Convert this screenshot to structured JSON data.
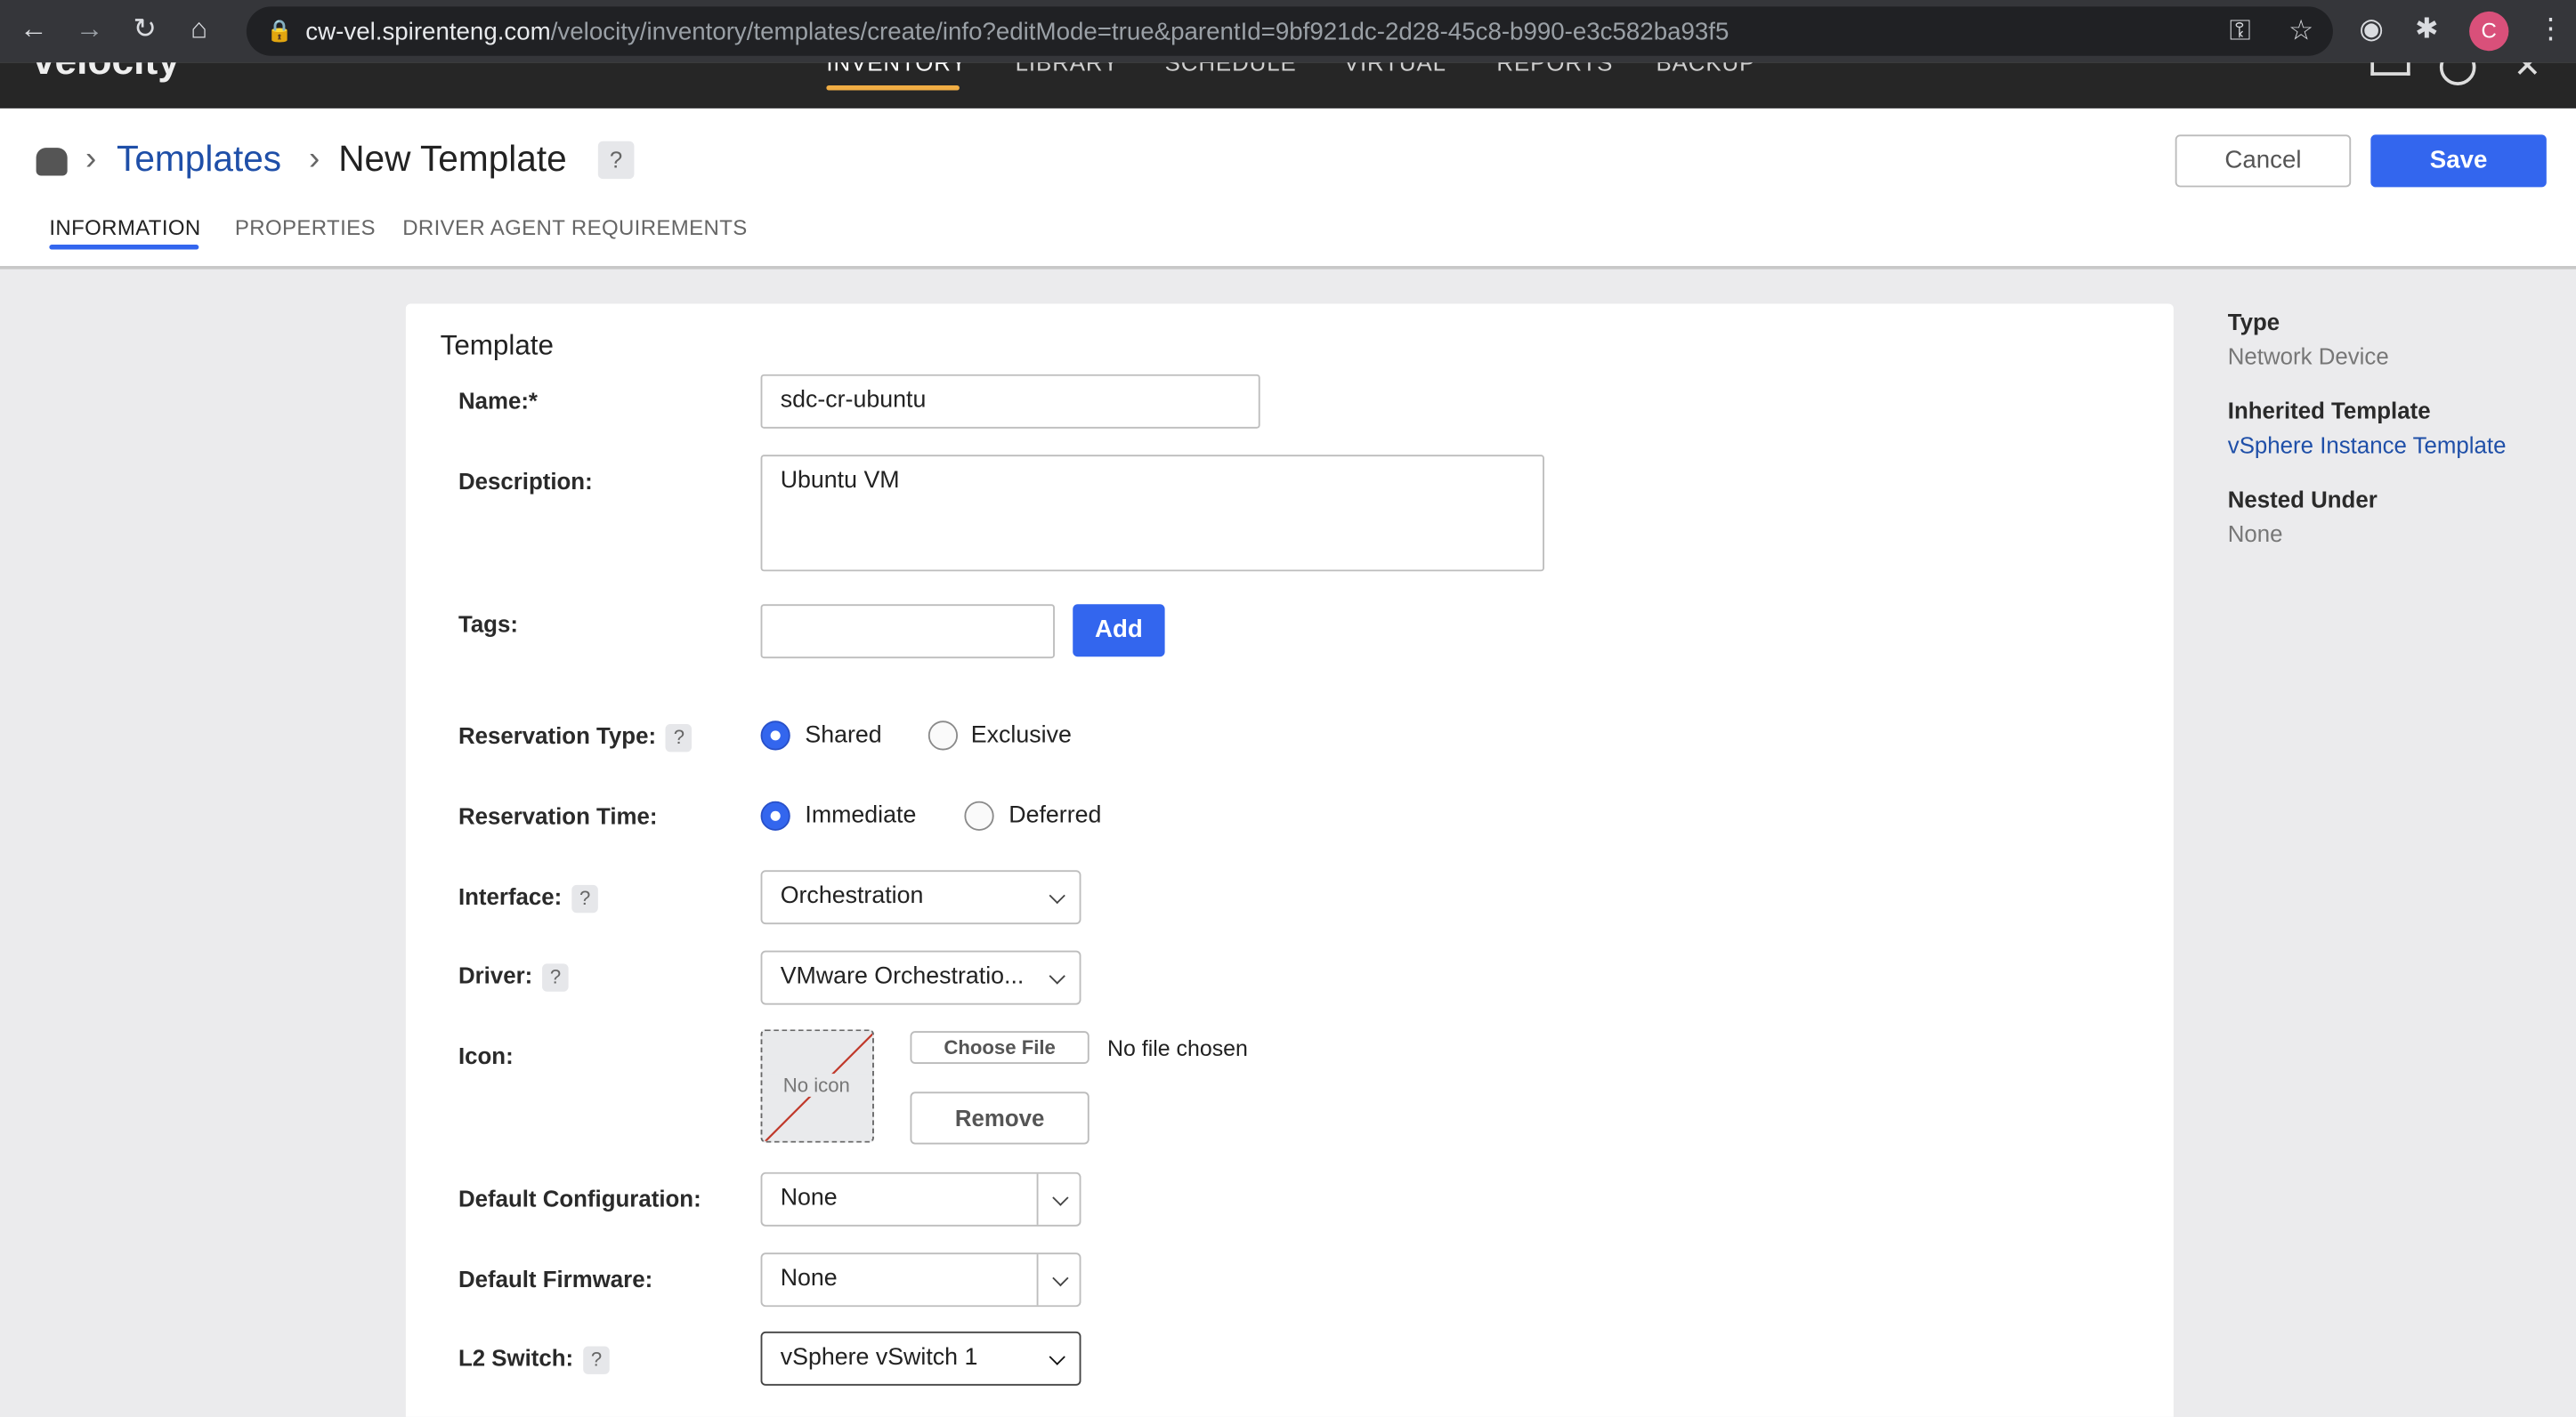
{
  "browser": {
    "url_host": "cw-vel.spirenteng.com",
    "url_path": "/velocity/inventory/templates/create/info?editMode=true&parentId=9bf921dc-2d28-45c8-b990-e3c582ba93f5",
    "profile_initial": "C"
  },
  "app": {
    "logo": "velocity",
    "nav": [
      "INVENTORY",
      "LIBRARY",
      "SCHEDULE",
      "VIRTUAL",
      "REPORTS",
      "BACKUP"
    ],
    "active_nav": "INVENTORY",
    "accent": "#f0ad44"
  },
  "header": {
    "breadcrumb_parent": "Templates",
    "title": "New Template",
    "help": "?",
    "cancel": "Cancel",
    "save": "Save"
  },
  "tabs": [
    "INFORMATION",
    "PROPERTIES",
    "DRIVER AGENT REQUIREMENTS"
  ],
  "form": {
    "section": "Template",
    "name_label": "Name:*",
    "name_value": "sdc-cr-ubuntu",
    "description_label": "Description:",
    "description_value": "Ubuntu VM",
    "tags_label": "Tags:",
    "tags_value": "",
    "add": "Add",
    "reservation_type_label": "Reservation Type:",
    "reservation_type_options": [
      "Shared",
      "Exclusive"
    ],
    "reservation_type_selected": "Shared",
    "reservation_time_label": "Reservation Time:",
    "reservation_time_options": [
      "Immediate",
      "Deferred"
    ],
    "reservation_time_selected": "Immediate",
    "interface_label": "Interface:",
    "interface_value": "Orchestration",
    "driver_label": "Driver:",
    "driver_value": "VMware Orchestratio...",
    "icon_label": "Icon:",
    "no_icon": "No icon",
    "choose_file": "Choose File",
    "no_file": "No file chosen",
    "remove": "Remove",
    "default_config_label": "Default Configuration:",
    "default_config_value": "None",
    "default_firmware_label": "Default Firmware:",
    "default_firmware_value": "None",
    "l2_switch_label": "L2 Switch:",
    "l2_switch_value": "vSphere vSwitch 1",
    "help": "?"
  },
  "side": {
    "type_label": "Type",
    "type_value": "Network Device",
    "inherited_label": "Inherited Template",
    "inherited_value": "vSphere Instance Template",
    "nested_label": "Nested Under",
    "nested_value": "None"
  },
  "colors": {
    "primary": "#3366ee",
    "link": "#1f4fa8"
  }
}
